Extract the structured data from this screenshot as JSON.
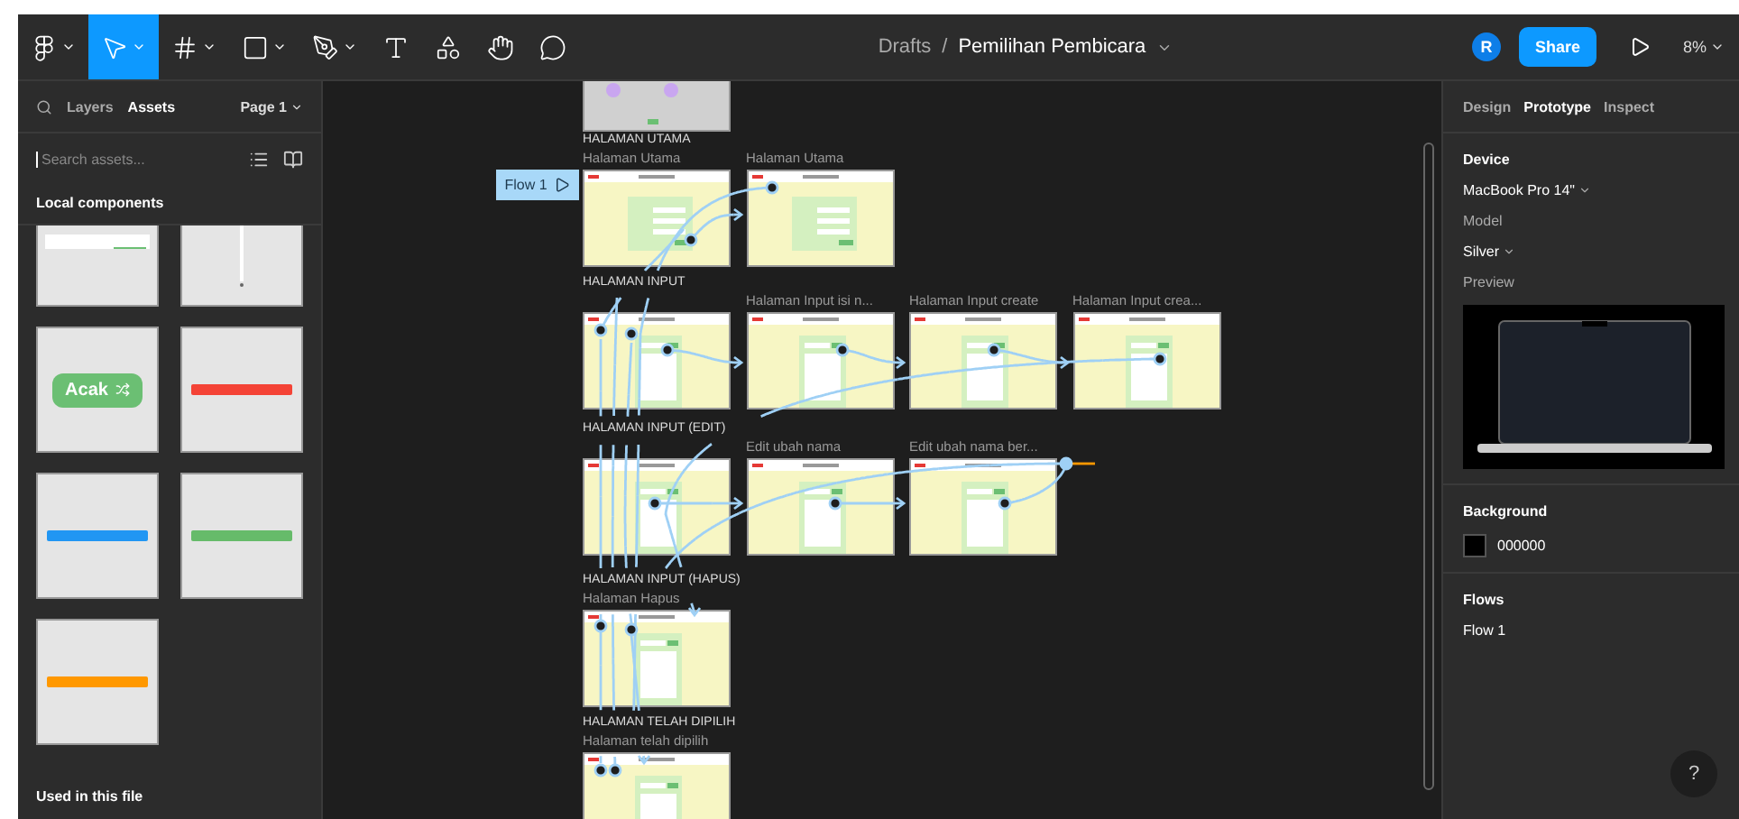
{
  "toolbar": {
    "tools": [
      {
        "kind": "menu",
        "selected": false
      },
      {
        "kind": "move",
        "selected": true
      },
      {
        "kind": "frame",
        "selected": false
      },
      {
        "kind": "shape",
        "selected": false
      },
      {
        "kind": "pen",
        "selected": false
      },
      {
        "kind": "text",
        "selected": false
      },
      {
        "kind": "resources",
        "selected": false
      },
      {
        "kind": "hand",
        "selected": false
      },
      {
        "kind": "comment",
        "selected": false
      }
    ],
    "breadcrumb": {
      "folder": "Drafts",
      "separator": "/",
      "file": "Pemilihan Pembicara"
    },
    "avatar": "R",
    "share": "Share",
    "zoom": "8%"
  },
  "left_panel": {
    "tabs": [
      {
        "label": "Layers",
        "selected": false
      },
      {
        "label": "Assets",
        "selected": true
      }
    ],
    "page": "Page 1",
    "search": {
      "placeholder": "Search assets..."
    },
    "section": "Local components",
    "components": [
      {
        "kind": "tabs"
      },
      {
        "kind": "scroll"
      },
      {
        "kind": "button",
        "label": "Acak"
      },
      {
        "kind": "alert",
        "color": "#f44336"
      },
      {
        "kind": "alert",
        "color": "#2196f3"
      },
      {
        "kind": "alert",
        "color": "#66bb6a"
      },
      {
        "kind": "alert",
        "color": "#ff9800"
      }
    ],
    "footer": "Used in this file"
  },
  "canvas": {
    "flow_tag": "Flow 1",
    "rows": [
      {
        "frames": [
          {
            "kind": "cut"
          }
        ]
      },
      {
        "frames": [
          {
            "kind": "form",
            "title": "HALAMAN UTAMA",
            "subtitle": "Halaman Utama"
          },
          {
            "kind": "form",
            "subtitle": "Halaman Utama"
          }
        ]
      },
      {
        "frames": [
          {
            "kind": "list",
            "title": "HALAMAN INPUT"
          },
          {
            "kind": "list",
            "subtitle": "Halaman Input isi n..."
          },
          {
            "kind": "list",
            "subtitle": "Halaman Input create"
          },
          {
            "kind": "list",
            "subtitle": "Halaman Input crea..."
          }
        ]
      },
      {
        "frames": [
          {
            "kind": "list",
            "title": "HALAMAN INPUT (EDIT)"
          },
          {
            "kind": "list",
            "subtitle": "Edit ubah nama"
          },
          {
            "kind": "list",
            "subtitle": "Edit ubah nama ber..."
          }
        ]
      },
      {
        "frames": [
          {
            "kind": "list",
            "title": "HALAMAN INPUT (HAPUS)",
            "subtitle": "Halaman Hapus"
          }
        ]
      },
      {
        "frames": [
          {
            "kind": "list",
            "title": "HALAMAN TELAH DIPILIH",
            "subtitle": "Halaman telah dipilih"
          }
        ]
      }
    ]
  },
  "right_panel": {
    "tabs": [
      {
        "label": "Design",
        "selected": false
      },
      {
        "label": "Prototype",
        "selected": true
      },
      {
        "label": "Inspect",
        "selected": false
      }
    ],
    "device": {
      "heading": "Device",
      "value": "MacBook Pro 14\"",
      "model_label": "Model",
      "model": "Silver",
      "preview_label": "Preview"
    },
    "background": {
      "heading": "Background",
      "color": "#000000",
      "value": "000000"
    },
    "flows": {
      "heading": "Flows",
      "items": [
        "Flow 1"
      ]
    },
    "help": "?"
  }
}
